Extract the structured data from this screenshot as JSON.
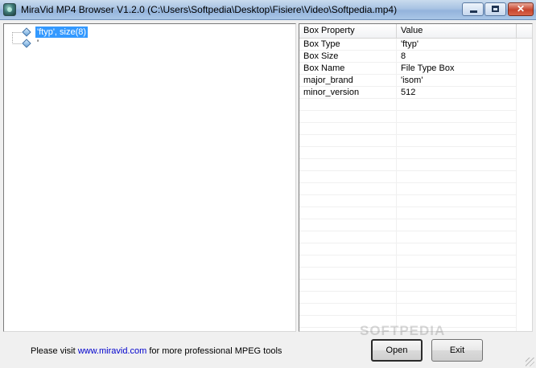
{
  "window": {
    "title": "MiraVid MP4 Browser V1.2.0 (C:\\Users\\Softpedia\\Desktop\\Fisiere\\Video\\Softpedia.mp4)",
    "close_glyph": "✕"
  },
  "tree": {
    "nodes": [
      {
        "label": "'ftyp', size(8)",
        "selected": true
      },
      {
        "label": "'",
        "selected": false
      }
    ]
  },
  "properties": {
    "headers": [
      "Box Property",
      "Value"
    ],
    "rows": [
      {
        "property": "Box Type",
        "value": "'ftyp'"
      },
      {
        "property": "Box Size",
        "value": "8"
      },
      {
        "property": "Box Name",
        "value": "File Type Box"
      },
      {
        "property": "major_brand",
        "value": "'isom'"
      },
      {
        "property": "minor_version",
        "value": "512"
      }
    ]
  },
  "footer": {
    "prefix": "Please visit ",
    "link": "www.miravid.com",
    "suffix": " for more professional MPEG tools"
  },
  "buttons": {
    "open": "Open",
    "exit": "Exit"
  },
  "watermark": "SOFTPEDIA",
  "colors": {
    "selection": "#3399ff",
    "link": "#0000cc"
  }
}
